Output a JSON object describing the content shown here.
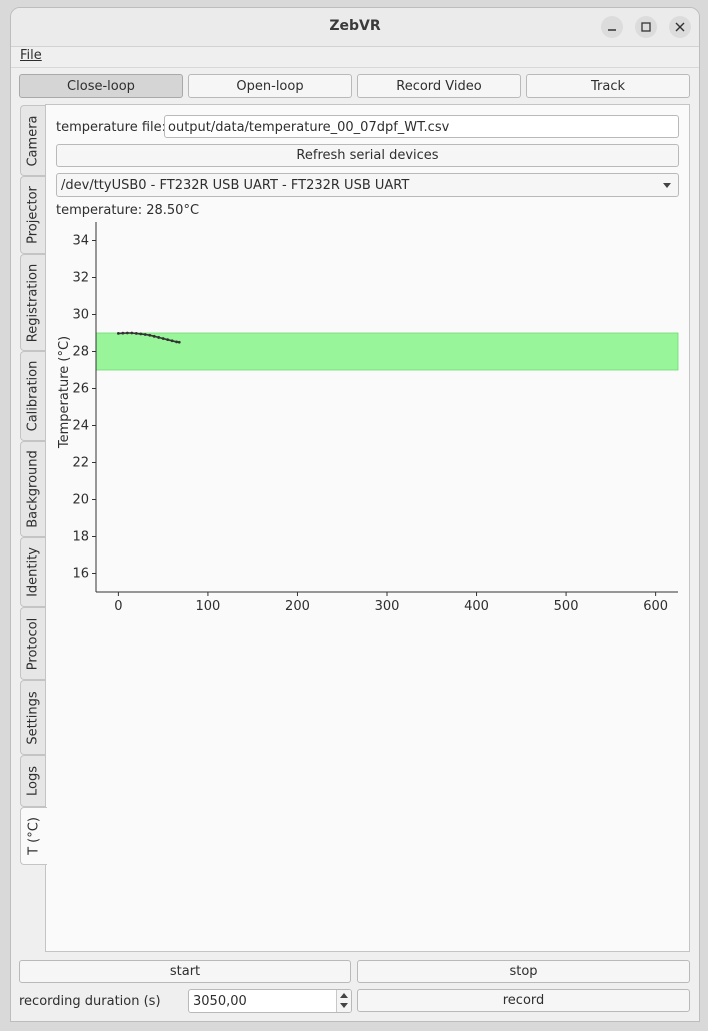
{
  "window": {
    "title": "ZebVR"
  },
  "menu": {
    "file": "File"
  },
  "modes": [
    {
      "label": "Close-loop",
      "checked": true
    },
    {
      "label": "Open-loop",
      "checked": false
    },
    {
      "label": "Record Video",
      "checked": false
    },
    {
      "label": "Track",
      "checked": false
    }
  ],
  "tabs": [
    "Camera",
    "Projector",
    "Registration",
    "Calibration",
    "Background",
    "Identity",
    "Protocol",
    "Settings",
    "Logs",
    "T (°C)"
  ],
  "active_tab": "T (°C)",
  "temperature_panel": {
    "file_label": "temperature file:",
    "file_value": "output/data/temperature_00_07dpf_WT.csv",
    "refresh_button": "Refresh serial devices",
    "device_selected": "/dev/ttyUSB0 - FT232R USB UART - FT232R USB UART",
    "reading": "temperature: 28.50°C"
  },
  "chart_data": {
    "type": "line",
    "title": "",
    "xlabel": "",
    "ylabel": "Temperature (°C)",
    "xlim": [
      -25,
      625
    ],
    "ylim": [
      15,
      35
    ],
    "xticks": [
      0,
      100,
      200,
      300,
      400,
      500,
      600
    ],
    "yticks": [
      16,
      18,
      20,
      22,
      24,
      26,
      28,
      30,
      32,
      34
    ],
    "grid": false,
    "target_band": {
      "min": 27,
      "max": 29,
      "color": "#99f599"
    },
    "line_color": "#333333",
    "series": [
      {
        "x": [
          0,
          5,
          10,
          15,
          20,
          25,
          30,
          35,
          40,
          45,
          50,
          55,
          60,
          65,
          68
        ],
        "values": [
          28.98,
          28.99,
          29.0,
          29.0,
          28.98,
          28.95,
          28.92,
          28.88,
          28.82,
          28.76,
          28.7,
          28.64,
          28.58,
          28.52,
          28.5
        ]
      }
    ]
  },
  "footer": {
    "start": "start",
    "stop": "stop",
    "duration_label": "recording duration (s)",
    "duration_value": "3050,00",
    "record": "record"
  }
}
